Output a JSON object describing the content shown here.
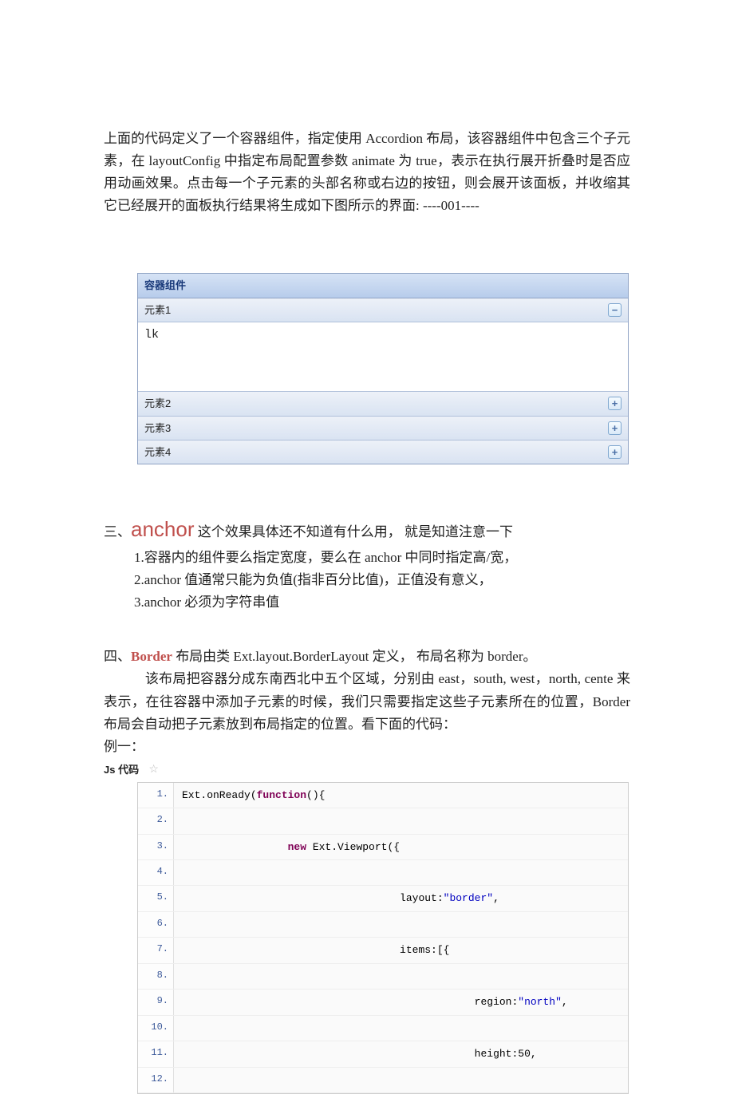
{
  "p1": "上面的代码定义了一个容器组件，指定使用 Accordion 布局，该容器组件中包含三个子元素，在 layoutConfig 中指定布局配置参数 animate 为 true，表示在执行展开折叠时是否应用动画效果。点击每一个子元素的头部名称或右边的按钮，则会展开该面板，并收缩其它已经展开的面板执行结果将生成如下图所示的界面: ----001----",
  "accordion": {
    "title": "容器组件",
    "items": [
      {
        "label": "元素1",
        "state": "collapse"
      },
      {
        "label": "元素2",
        "state": "expand"
      },
      {
        "label": "元素3",
        "state": "expand"
      },
      {
        "label": "元素4",
        "state": "expand"
      }
    ],
    "body": "lk",
    "icon_collapse": "−",
    "icon_expand": "+"
  },
  "sec3": {
    "prefix": "三、",
    "anchor": "anchor",
    "tail": " 这个效果具体还不知道有什么用， 就是知道注意一下",
    "l1": "1.容器内的组件要么指定宽度，要么在 anchor 中同时指定高/宽，",
    "l2": "2.anchor 值通常只能为负值(指非百分比值)，正值没有意义，",
    "l3": "3.anchor 必须为字符串值"
  },
  "sec4": {
    "line1_pre": "四、",
    "line1_border": "Border",
    "line1_post": " 布局由类 Ext.layout.BorderLayout 定义， 布局名称为 border。",
    "body": "该布局把容器分成东南西北中五个区域，分别由 east，south, west，north, cente 来表示，在往容器中添加子元素的时候，我们只需要指定这些子元素所在的位置，Border 布局会自动把子元素放到布局指定的位置。看下面的代码：",
    "ex": "例一：",
    "code_label": "Js 代码"
  },
  "code": {
    "lines": [
      {
        "n": "1.",
        "indent": 0,
        "tokens": [
          {
            "t": "Ext.onReady("
          },
          {
            "t": "function",
            "c": "kw"
          },
          {
            "t": "(){  "
          }
        ]
      },
      {
        "n": "2.",
        "indent": 0,
        "tokens": [
          {
            "t": "  "
          }
        ]
      },
      {
        "n": "3.",
        "indent": 17,
        "tokens": [
          {
            "t": "new",
            "c": "kw"
          },
          {
            "t": " Ext.Viewport({  "
          }
        ]
      },
      {
        "n": "4.",
        "indent": 0,
        "tokens": [
          {
            "t": "  "
          }
        ]
      },
      {
        "n": "5.",
        "indent": 35,
        "tokens": [
          {
            "t": "layout:"
          },
          {
            "t": "\"border\"",
            "c": "str"
          },
          {
            "t": ",  "
          }
        ]
      },
      {
        "n": "6.",
        "indent": 0,
        "tokens": [
          {
            "t": "  "
          }
        ]
      },
      {
        "n": "7.",
        "indent": 35,
        "tokens": [
          {
            "t": "items:[{  "
          }
        ]
      },
      {
        "n": "8.",
        "indent": 0,
        "tokens": [
          {
            "t": "  "
          }
        ]
      },
      {
        "n": "9.",
        "indent": 47,
        "tokens": [
          {
            "t": "region:"
          },
          {
            "t": "\"north\"",
            "c": "str"
          },
          {
            "t": ",  "
          }
        ]
      },
      {
        "n": "10.",
        "indent": 0,
        "tokens": [
          {
            "t": "  "
          }
        ]
      },
      {
        "n": "11.",
        "indent": 47,
        "tokens": [
          {
            "t": "height:50,  "
          }
        ]
      },
      {
        "n": "12.",
        "indent": 0,
        "tokens": [
          {
            "t": "  "
          }
        ]
      }
    ]
  }
}
